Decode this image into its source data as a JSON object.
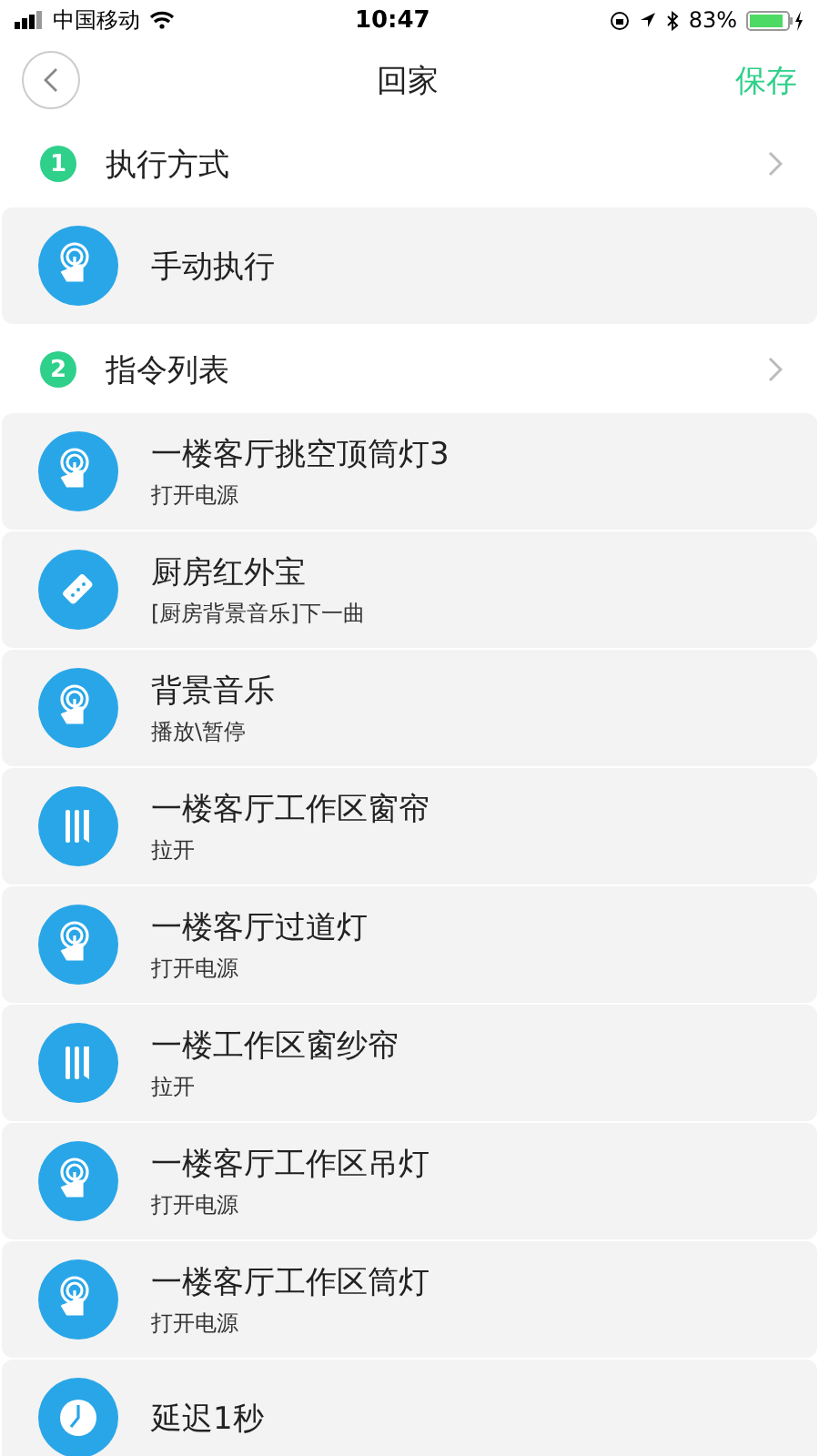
{
  "status_bar": {
    "carrier": "中国移动",
    "time": "10:47",
    "battery": "83%"
  },
  "nav": {
    "title": "回家",
    "action": "保存"
  },
  "sections": [
    {
      "number": "1",
      "title": "执行方式",
      "items": [
        {
          "kind": "touch",
          "title": "手动执行"
        }
      ]
    },
    {
      "number": "2",
      "title": "指令列表",
      "items": [
        {
          "kind": "touch",
          "title": "一楼客厅挑空顶筒灯3",
          "subtitle": "打开电源"
        },
        {
          "kind": "remote",
          "title": "厨房红外宝",
          "subtitle": "[厨房背景音乐]下一曲"
        },
        {
          "kind": "touch",
          "title": "背景音乐",
          "subtitle": "播放\\暂停"
        },
        {
          "kind": "curtain",
          "title": "一楼客厅工作区窗帘",
          "subtitle": "拉开"
        },
        {
          "kind": "touch",
          "title": "一楼客厅过道灯",
          "subtitle": "打开电源"
        },
        {
          "kind": "curtain",
          "title": "一楼工作区窗纱帘",
          "subtitle": "拉开"
        },
        {
          "kind": "touch",
          "title": "一楼客厅工作区吊灯",
          "subtitle": "打开电源"
        },
        {
          "kind": "touch",
          "title": "一楼客厅工作区筒灯",
          "subtitle": "打开电源"
        },
        {
          "kind": "clock",
          "title": "延迟1秒"
        }
      ]
    }
  ]
}
